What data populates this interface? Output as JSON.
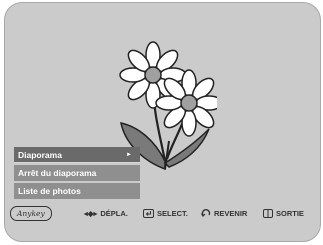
{
  "menu": {
    "items": [
      {
        "label": "Diaporama",
        "arrow": "►",
        "selected": true
      },
      {
        "label": "Arrêt du diaporama"
      },
      {
        "label": "Liste de photos"
      }
    ]
  },
  "bottom_bar": {
    "anykey": "Anykey",
    "move": {
      "icon": "◂◆▸",
      "label": "DÉPLA."
    },
    "select": {
      "icon": "enter-icon",
      "label": "SELECT."
    },
    "back": {
      "icon": "return-icon",
      "label": "REVENIR"
    },
    "exit": {
      "icon": "exit-icon",
      "label": "SORTIE"
    }
  },
  "colors": {
    "screen_bg": "#cbcbcb",
    "menu_item_bg": "#8f8f8f",
    "menu_selected_bg": "#6a6a6a"
  }
}
